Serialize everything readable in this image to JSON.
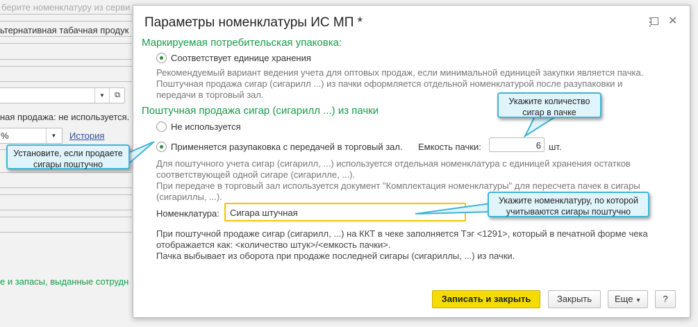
{
  "background": {
    "top_text": "берите номенклатуру из серви",
    "field1": "ьтернативная табачная продук",
    "retail_text": "ная продажа: не используется.",
    "vat_value": "%",
    "history_link": "История",
    "green_text": "е и запасы, выданные сотрудн"
  },
  "dialog": {
    "title": "Параметры номенклатуры ИС МП *",
    "section1": "Маркируемая потребительская упаковка:",
    "radio1": "Соответствует единице хранения",
    "desc1": [
      "Рекомендуемый вариант ведения учета для оптовых продаж, если минимальной единицей закупки является пачка.",
      "Поштучная продажа сигар (сигарилл ...) из пачки оформляется отдельной номенклатурой после разупаковки и",
      "передачи в торговый зал."
    ],
    "section2": "Поштучная продажа сигар (сигарилл ...) из пачки",
    "radio_not_used": "Не используется",
    "radio_unpack": "Применяется разупаковка с передачей в торговый зал.",
    "capacity_label": "Емкость пачки:",
    "capacity_value": "6",
    "capacity_unit": "шт.",
    "desc2": [
      "Для поштучного учета сигар (сигарилл, ...) используется отдельная номенклатура с единицей хранения остатков",
      "соответствующей одной сигаре (сигарилле, ...).",
      "При передаче в торговый зал используется документ \"Комплектация номенклатуры\" для пересчета пачек в сигары",
      "(сигариллы, ...)."
    ],
    "nomenclature_label": "Номенклатура:",
    "nomenclature_value": "Сигара штучная",
    "desc3": [
      "При поштучной продаже сигар (сигарилл, ...) на ККТ в чеке заполняется Тэг <1291>, который в печатной форме чека",
      "отображается как: <количество штук>/<емкость пачки>.",
      "Пачка выбывает из оборота при продаже последней сигары (сигариллы, ...) из пачки."
    ],
    "buttons": {
      "save_close": "Записать и закрыть",
      "close": "Закрыть",
      "more": "Еще",
      "help": "?"
    }
  },
  "callouts": {
    "unpack": [
      "Установите, если продаете",
      "сигары поштучно"
    ],
    "capacity": [
      "Укажите количество",
      "сигар в пачке"
    ],
    "nomenclature": [
      "Укажите номенклатуру, по которой",
      "учитываются сигары поштучно"
    ]
  },
  "colors": {
    "accent_green": "#1a9a4a",
    "primary_button": "#f5dc00",
    "callout_border": "#3fb4d6"
  }
}
